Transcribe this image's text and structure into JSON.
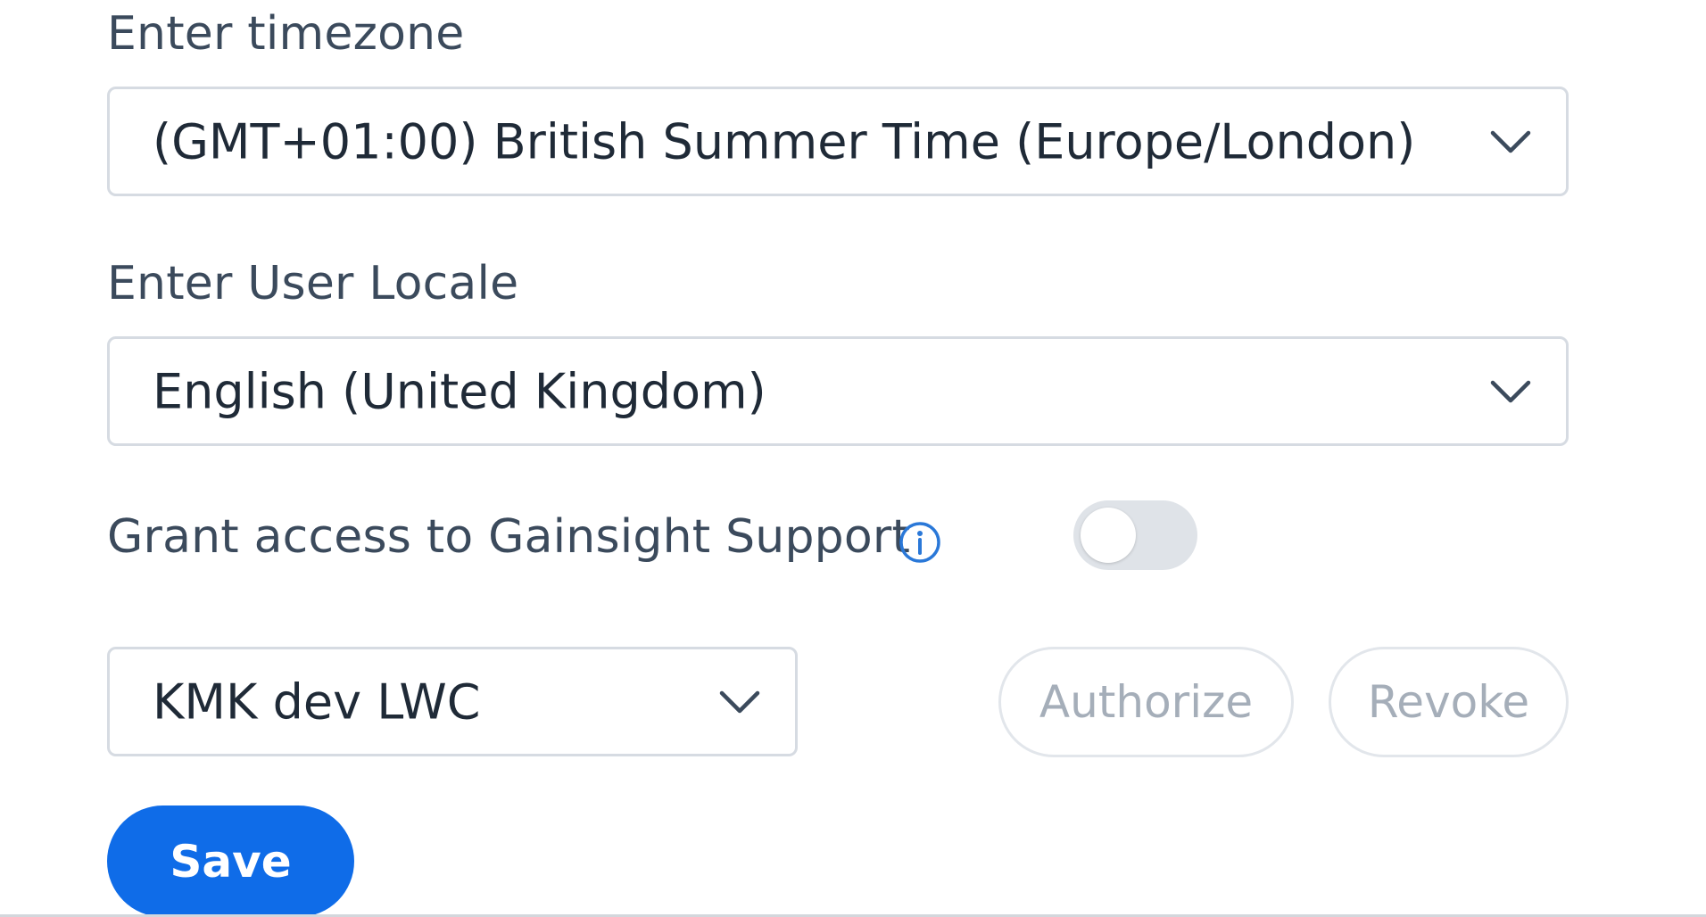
{
  "timezone": {
    "label": "Enter timezone",
    "value": "(GMT+01:00) British Summer Time (Europe/London)"
  },
  "locale": {
    "label": "Enter User Locale",
    "value": "English (United Kingdom)"
  },
  "support_access": {
    "label": "Grant access to Gainsight Support",
    "info_icon": "info-icon",
    "toggle_on": false,
    "org_value": "KMK dev LWC",
    "authorize_label": "Authorize",
    "revoke_label": "Revoke"
  },
  "actions": {
    "save_label": "Save"
  },
  "colors": {
    "primary": "#0f6ce8",
    "info_icon": "#2a78d8",
    "toggle_off": "#dfe3e8",
    "border": "#d6dbe2",
    "disabled_text": "#a5aeb9"
  }
}
